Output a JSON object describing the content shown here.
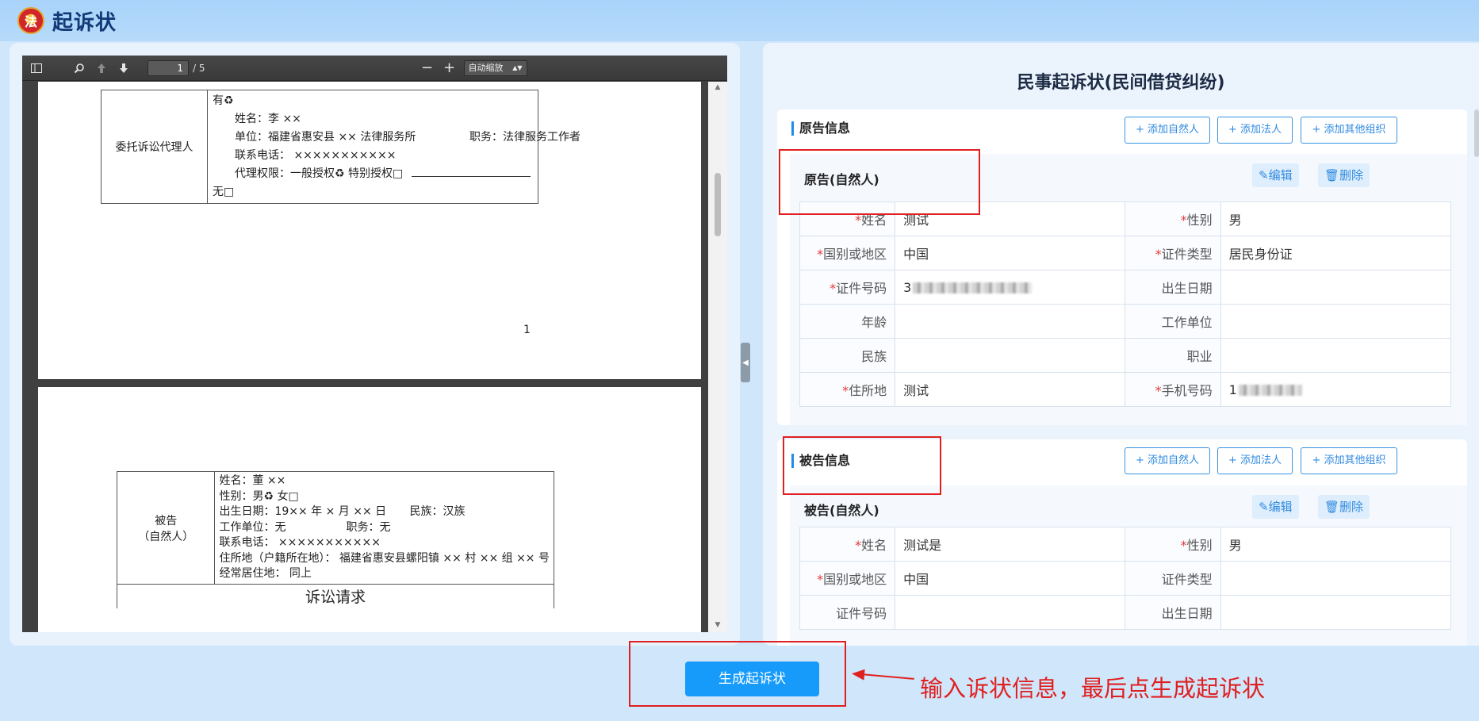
{
  "header": {
    "emblem_glyph": "法",
    "title": "起诉状"
  },
  "pdf_viewer": {
    "sidebar_icon": "sidebar-toggle-icon",
    "search_icon": "search-icon",
    "current_page": "1",
    "total_pages": "/ 5",
    "zoom_out": "−",
    "zoom_in": "+",
    "zoom_label": "自动缩放",
    "page1": {
      "agent_label": "委托诉讼代理人",
      "lines": [
        "有♻",
        "姓名：李  ××",
        "单位：福建省惠安县  ××  法律服务所",
        "职务：法律服务工作者",
        "联系电话：  ×××××××××××",
        "代理权限：一般授权♻    特别授权□",
        "无□"
      ],
      "page_number": "1"
    },
    "page2": {
      "defendant_label_1": "被告",
      "defendant_label_2": "（自然人）",
      "lines": [
        "姓名：董  ××",
        "性别：男♻    女□",
        "出生日期：19×× 年  × 月  ××  日",
        "民族：汉族",
        "工作单位：无",
        "职务：无",
        "联系电话：  ×××××××××××",
        "住所地（户籍所在地）：  福建省惠安县螺阳镇  ×× 村  ×× 组  ×× 号",
        "经常居住地：  同上"
      ],
      "heading": "诉讼请求"
    }
  },
  "form": {
    "title": "民事起诉状(民间借贷纠纷)",
    "add_natural": "+ 添加自然人",
    "add_legal": "+ 添加法人",
    "add_other": "+ 添加其他组织",
    "edit": "编辑",
    "delete": "删除",
    "plaintiff": {
      "section_title": "原告信息",
      "card_title": "原告(自然人)",
      "rows": [
        {
          "l1": "姓名",
          "r1": true,
          "v1": "测试",
          "l2": "性别",
          "r2": true,
          "v2": "男"
        },
        {
          "l1": "国别或地区",
          "r1": true,
          "v1": "中国",
          "l2": "证件类型",
          "r2": true,
          "v2": "居民身份证"
        },
        {
          "l1": "证件号码",
          "r1": true,
          "v1": "3",
          "l2": "出生日期",
          "r2": false,
          "v2": ""
        },
        {
          "l1": "年龄",
          "r1": false,
          "v1": "",
          "l2": "工作单位",
          "r2": false,
          "v2": ""
        },
        {
          "l1": "民族",
          "r1": false,
          "v1": "",
          "l2": "职业",
          "r2": false,
          "v2": ""
        },
        {
          "l1": "住所地",
          "r1": true,
          "v1": "测试",
          "l2": "手机号码",
          "r2": true,
          "v2": "1"
        }
      ]
    },
    "defendant": {
      "section_title": "被告信息",
      "card_title": "被告(自然人)",
      "rows": [
        {
          "l1": "姓名",
          "r1": true,
          "v1": "测试是",
          "l2": "性别",
          "r2": true,
          "v2": "男"
        },
        {
          "l1": "国别或地区",
          "r1": true,
          "v1": "中国",
          "l2": "证件类型",
          "r2": false,
          "v2": ""
        },
        {
          "l1": "证件号码",
          "r1": false,
          "v1": "",
          "l2": "出生日期",
          "r2": false,
          "v2": ""
        }
      ]
    }
  },
  "footer": {
    "generate_button": "生成起诉状",
    "hint": "输入诉状信息，最后点生成起诉状"
  },
  "colors": {
    "accent": "#169bfa",
    "annotation": "#e02020",
    "required": "#e23b3b"
  }
}
